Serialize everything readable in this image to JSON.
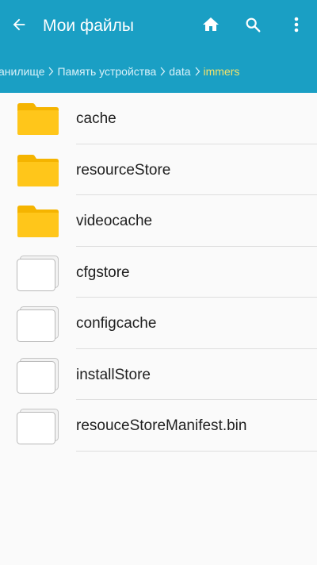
{
  "header": {
    "title": "Мои файлы",
    "back_icon": "arrow-left-icon",
    "home_icon": "home-icon",
    "search_icon": "search-icon",
    "more_icon": "more-vert-icon",
    "bg_color": "#1a9fc4"
  },
  "breadcrumb": {
    "items": [
      {
        "label": "анилище"
      },
      {
        "label": "Память устройства"
      },
      {
        "label": "data"
      },
      {
        "label": "immers"
      }
    ],
    "active_color": "#f4e36b"
  },
  "files": [
    {
      "name": "cache",
      "type": "folder"
    },
    {
      "name": "resourceStore",
      "type": "folder"
    },
    {
      "name": "videocache",
      "type": "folder"
    },
    {
      "name": "cfgstore",
      "type": "file"
    },
    {
      "name": "configcache",
      "type": "file"
    },
    {
      "name": "installStore",
      "type": "file"
    },
    {
      "name": "resouceStoreManifest.bin",
      "type": "file"
    }
  ]
}
